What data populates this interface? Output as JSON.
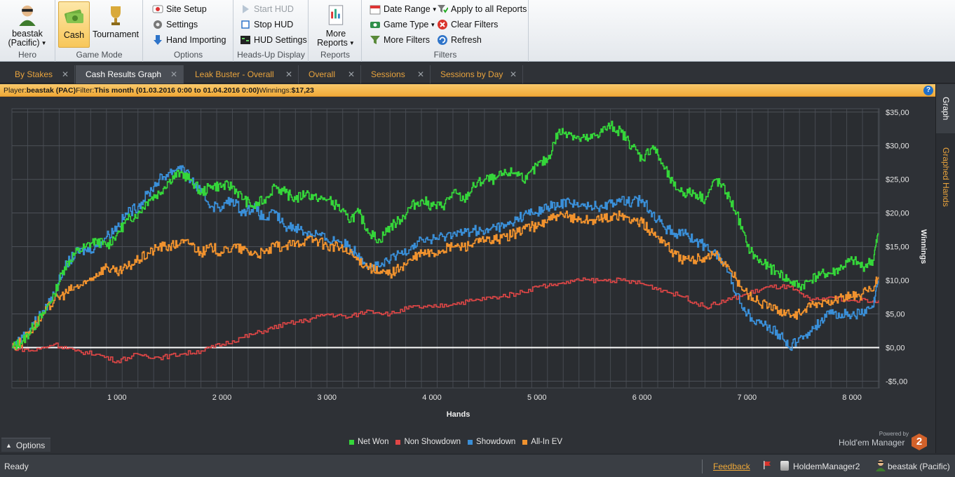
{
  "ribbon": {
    "hero": {
      "label_line1": "beastak",
      "label_line2": "(Pacific)",
      "group": "Hero"
    },
    "game_mode": {
      "cash": "Cash",
      "tournament": "Tournament",
      "group": "Game Mode"
    },
    "options": {
      "site_setup": "Site Setup",
      "settings": "Settings",
      "hand_importing": "Hand Importing",
      "group": "Options"
    },
    "hud": {
      "start": "Start HUD",
      "stop": "Stop HUD",
      "settings": "HUD Settings",
      "group": "Heads-Up Display"
    },
    "reports": {
      "more_line1": "More",
      "more_line2": "Reports",
      "group": "Reports"
    },
    "filters": {
      "date_range": "Date Range",
      "game_type": "Game Type",
      "more_filters": "More Filters",
      "apply_all": "Apply to all Reports",
      "clear": "Clear Filters",
      "refresh": "Refresh",
      "group": "Filters"
    }
  },
  "tabs": [
    "By Stakes",
    "Cash Results Graph",
    "Leak Buster - Overall",
    "Overall",
    "Sessions",
    "Sessions by Day"
  ],
  "active_tab": "Cash Results Graph",
  "info_bar": {
    "player_label": "Player:",
    "player": "beastak (PAC)",
    "filter_label": "Filter:",
    "filter": "This month (01.03.2016 0:00 to 01.04.2016 0:00)",
    "winnings_label": "Winnings:",
    "winnings": "$17,23",
    "help": "?"
  },
  "side_tabs": {
    "graph": "Graph",
    "graphed_hands": "Graphed Hands"
  },
  "chart_data": {
    "type": "line",
    "xlabel": "Hands",
    "ylabel": "Winnings",
    "xlim": [
      0,
      8260
    ],
    "ylim": [
      -6,
      35.5
    ],
    "x_ticks": [
      "1 000",
      "2 000",
      "3 000",
      "4 000",
      "5 000",
      "6 000",
      "7 000",
      "8 000"
    ],
    "x_tick_values": [
      1000,
      2000,
      3000,
      4000,
      5000,
      6000,
      7000,
      8000
    ],
    "y_ticks": [
      "$35,00",
      "$30,00",
      "$25,00",
      "$20,00",
      "$15,00",
      "$10,00",
      "$5,00",
      "$0,00",
      "-$5,00"
    ],
    "y_tick_values": [
      35,
      30,
      25,
      20,
      15,
      10,
      5,
      0,
      -5
    ],
    "grid": true,
    "legend_position": "bottom",
    "series": [
      {
        "name": "Net Won",
        "color": "#35d63a",
        "x": [
          0,
          100,
          200,
          300,
          400,
          500,
          600,
          700,
          800,
          900,
          1000,
          1100,
          1200,
          1300,
          1400,
          1500,
          1600,
          1700,
          1800,
          1900,
          2000,
          2100,
          2200,
          2300,
          2400,
          2500,
          2600,
          2700,
          2800,
          2900,
          3000,
          3100,
          3200,
          3300,
          3400,
          3500,
          3600,
          3700,
          3800,
          3900,
          4000,
          4100,
          4200,
          4300,
          4400,
          4500,
          4600,
          4700,
          4800,
          4900,
          5000,
          5100,
          5200,
          5300,
          5400,
          5500,
          5600,
          5700,
          5800,
          5900,
          6000,
          6100,
          6200,
          6300,
          6400,
          6500,
          6600,
          6700,
          6800,
          6900,
          7000,
          7100,
          7200,
          7300,
          7400,
          7500,
          7600,
          7700,
          7800,
          7900,
          8000,
          8100,
          8200,
          8250
        ],
        "y": [
          0,
          1,
          3,
          5,
          8,
          12,
          14,
          15,
          16,
          15,
          17,
          19,
          20,
          22,
          23,
          25,
          26,
          25,
          23,
          24,
          24,
          24,
          22,
          21,
          22,
          24,
          23,
          22,
          23,
          22,
          22,
          21,
          19,
          20,
          17,
          16,
          18,
          19,
          21,
          22,
          21,
          21,
          23,
          22,
          24,
          25,
          25,
          26,
          26,
          25,
          27,
          28,
          32,
          32,
          31,
          31,
          32,
          33,
          32,
          30,
          28,
          30,
          27,
          24,
          23,
          23,
          22,
          25,
          23,
          20,
          15,
          13,
          12,
          11,
          10,
          9,
          10,
          11,
          11,
          12,
          13,
          12,
          13,
          17
        ]
      },
      {
        "name": "Non Showdown",
        "color": "#e04646",
        "x": [
          0,
          200,
          400,
          600,
          800,
          1000,
          1200,
          1400,
          1600,
          1800,
          2000,
          2200,
          2400,
          2600,
          2800,
          3000,
          3200,
          3400,
          3600,
          3800,
          4000,
          4200,
          4400,
          4600,
          4800,
          5000,
          5200,
          5400,
          5600,
          5800,
          6000,
          6200,
          6400,
          6600,
          6800,
          7000,
          7200,
          7400,
          7600,
          7800,
          8000,
          8250
        ],
        "y": [
          0,
          -0.5,
          0.5,
          -0.5,
          -1,
          -2,
          -1,
          -1.5,
          -1,
          -0.5,
          0.5,
          1.5,
          2.5,
          3.5,
          4,
          5,
          4.5,
          5.5,
          5,
          6,
          6,
          6.5,
          7,
          7.5,
          8,
          9,
          9.5,
          10,
          10,
          10,
          9.5,
          8.5,
          7.5,
          6,
          7,
          8,
          9,
          9,
          7,
          7.5,
          7,
          7
        ]
      },
      {
        "name": "Showdown",
        "color": "#3a8fd8",
        "x": [
          0,
          100,
          200,
          300,
          400,
          500,
          600,
          700,
          800,
          900,
          1000,
          1100,
          1200,
          1300,
          1400,
          1500,
          1600,
          1700,
          1800,
          1900,
          2000,
          2100,
          2200,
          2300,
          2400,
          2500,
          2600,
          2700,
          2800,
          2900,
          3000,
          3100,
          3200,
          3300,
          3400,
          3500,
          3600,
          3700,
          3800,
          3900,
          4000,
          4100,
          4200,
          4300,
          4400,
          4500,
          4600,
          4700,
          4800,
          4900,
          5000,
          5100,
          5200,
          5300,
          5400,
          5500,
          5600,
          5700,
          5800,
          5900,
          6000,
          6100,
          6200,
          6300,
          6400,
          6500,
          6600,
          6700,
          6800,
          6900,
          7000,
          7100,
          7200,
          7300,
          7400,
          7500,
          7600,
          7700,
          7800,
          7900,
          8000,
          8100,
          8200,
          8250
        ],
        "y": [
          0,
          1.5,
          3.5,
          5.5,
          8,
          12,
          14,
          14.5,
          15,
          16.5,
          18,
          20,
          21,
          23,
          25,
          26,
          27,
          25,
          23,
          21,
          21,
          22,
          20,
          21,
          19,
          20,
          18,
          18,
          17,
          17,
          16,
          16,
          15,
          14,
          12,
          12,
          13,
          14,
          15,
          16,
          16,
          16.5,
          17,
          17,
          17.5,
          17,
          18,
          18,
          19,
          20,
          20,
          21,
          21,
          22,
          21,
          21,
          21,
          21.5,
          22,
          21.5,
          22,
          20,
          18,
          17,
          17,
          16,
          15,
          14,
          12,
          8,
          5,
          4,
          3,
          2,
          0,
          1.5,
          2.5,
          4,
          5,
          5,
          5,
          5,
          6,
          10
        ]
      },
      {
        "name": "All-In EV",
        "color": "#f0922e",
        "x": [
          0,
          100,
          200,
          300,
          400,
          500,
          600,
          700,
          800,
          900,
          1000,
          1100,
          1200,
          1300,
          1400,
          1500,
          1600,
          1700,
          1800,
          1900,
          2000,
          2100,
          2200,
          2300,
          2400,
          2500,
          2600,
          2700,
          2800,
          2900,
          3000,
          3100,
          3200,
          3300,
          3400,
          3500,
          3600,
          3700,
          3800,
          3900,
          4000,
          4100,
          4200,
          4300,
          4400,
          4500,
          4600,
          4700,
          4800,
          4900,
          5000,
          5100,
          5200,
          5300,
          5400,
          5500,
          5600,
          5700,
          5800,
          5900,
          6000,
          6100,
          6200,
          6300,
          6400,
          6500,
          6600,
          6700,
          6800,
          6900,
          7000,
          7100,
          7200,
          7300,
          7400,
          7500,
          7600,
          7700,
          7800,
          7900,
          8000,
          8100,
          8200,
          8250
        ],
        "y": [
          0,
          1,
          3,
          5,
          7,
          8,
          9,
          9.5,
          11,
          12,
          11,
          12,
          13,
          14,
          15,
          15,
          15.5,
          15.5,
          14,
          15,
          14,
          15,
          14.5,
          14,
          14,
          15,
          15,
          15.5,
          16,
          16,
          15,
          15,
          14,
          13,
          12,
          11,
          11,
          12,
          13,
          14,
          14,
          14.5,
          15,
          15,
          15.5,
          16,
          16,
          16.5,
          17,
          18,
          18,
          19,
          19.5,
          19.5,
          19,
          19,
          19,
          19.5,
          19.5,
          19,
          18.5,
          17,
          16,
          14,
          13,
          13,
          13.5,
          14,
          12,
          10,
          8,
          7,
          6,
          5.5,
          5,
          5,
          6,
          6.5,
          7,
          7.5,
          7.5,
          8,
          8.5,
          10.5
        ]
      }
    ]
  },
  "legend_items": [
    "Net Won",
    "Non Showdown",
    "Showdown",
    "All-In EV"
  ],
  "chart_footer": {
    "options": "Options",
    "powered_by": "Powered by",
    "brand": "Hold'em Manager",
    "brand_number": "2"
  },
  "status_bar": {
    "status": "Ready",
    "feedback": "Feedback",
    "database": "HoldemManager2",
    "user": "beastak (Pacific)"
  }
}
